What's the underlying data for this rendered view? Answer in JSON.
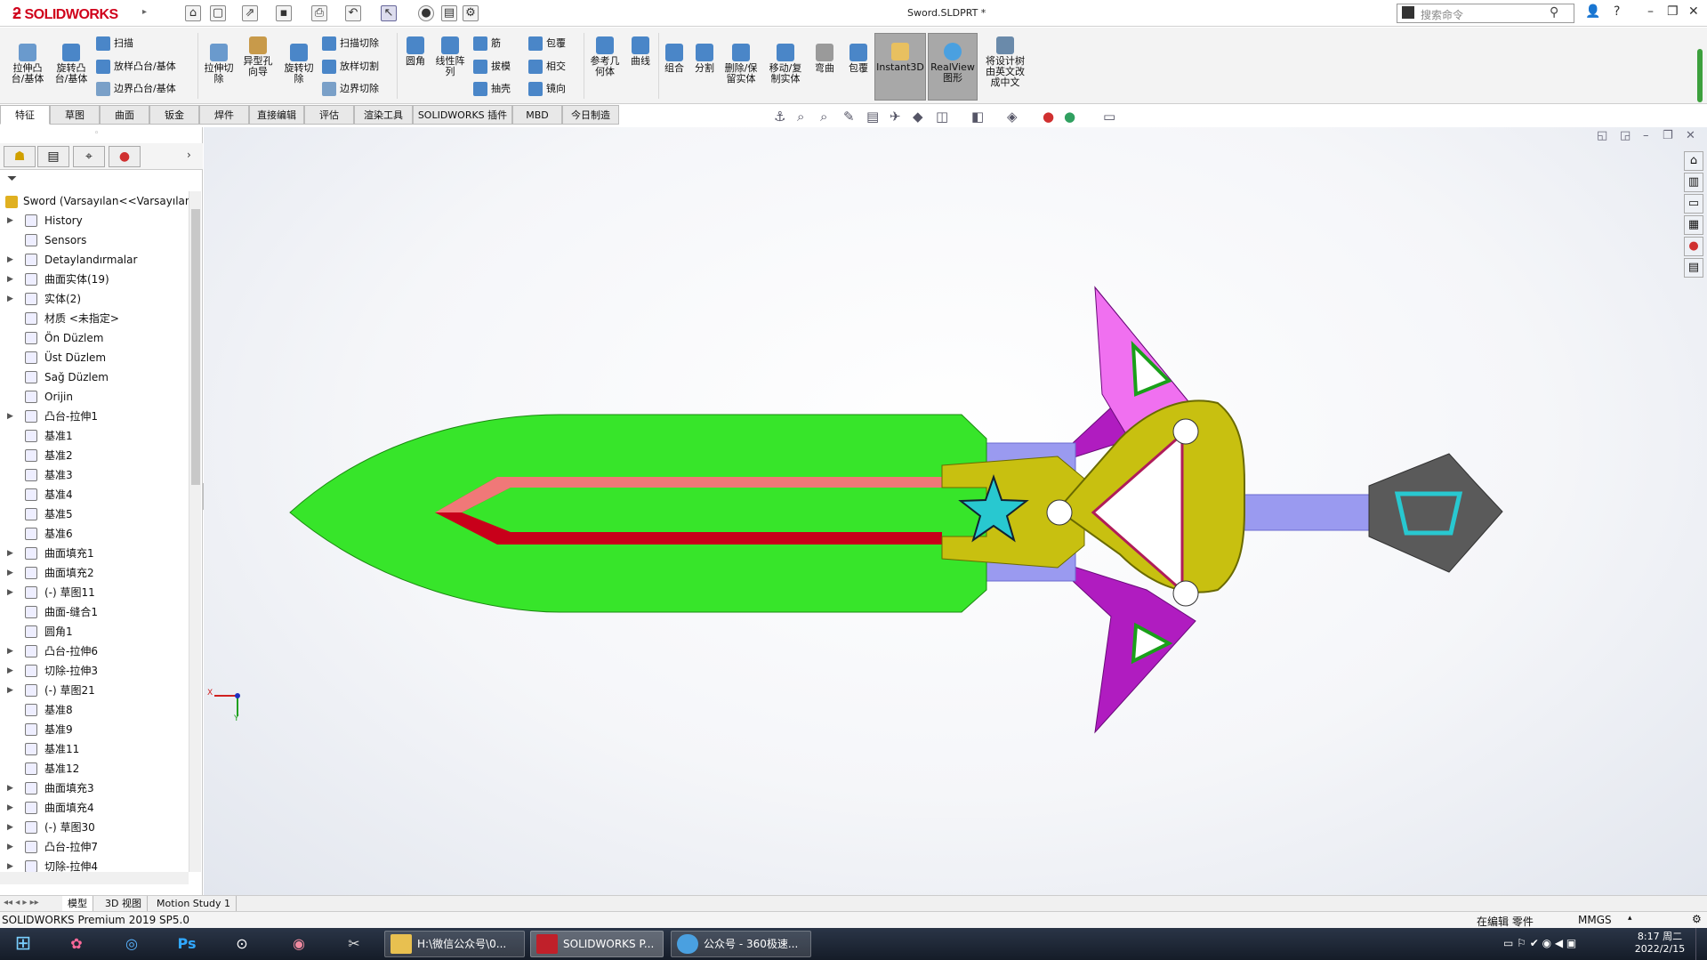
{
  "app": {
    "brand": "SOLIDWORKS",
    "document_title": "Sword.SLDPRT *",
    "search_placeholder": "搜索命令"
  },
  "ribbon": {
    "boss_extrude": "拉伸凸\n台/基体",
    "revolve_boss": "旋转凸\n台/基体",
    "sweep": "扫描",
    "loft_boss": "放样凸台/基体",
    "boundary_boss": "边界凸台/基体",
    "extrude_cut": "拉伸切\n除",
    "hole_wizard": "异型孔\n向导",
    "revolve_cut": "旋转切\n除",
    "swept_cut": "扫描切除",
    "lofted_cut": "放样切割",
    "boundary_cut": "边界切除",
    "fillet": "圆角",
    "linear_pattern": "线性阵\n列",
    "rib": "筋",
    "draft": "拔模",
    "shell": "抽壳",
    "wrap": "包覆",
    "intersect": "相交",
    "mirror": "镜向",
    "ref_geometry": "参考几\n何体",
    "curves": "曲线",
    "combine": "组合",
    "split": "分割",
    "delete_keep_body": "删除/保\n留实体",
    "move_copy_body": "移动/复\n制实体",
    "flex": "弯曲",
    "wrap2": "包覆",
    "instant3d": "Instant3D",
    "realview": "RealView\n图形",
    "translate_tree": "将设计树\n由英文改\n成中文"
  },
  "tabs": [
    "特征",
    "草图",
    "曲面",
    "钣金",
    "焊件",
    "直接编辑",
    "评估",
    "渲染工具",
    "SOLIDWORKS 插件",
    "MBD",
    "今日制造"
  ],
  "tree": {
    "root": "Sword  (Varsayılan<<Varsayılan",
    "items": [
      {
        "label": "History",
        "expand": true
      },
      {
        "label": "Sensors",
        "expand": false
      },
      {
        "label": "Detaylandırmalar",
        "expand": true
      },
      {
        "label": "曲面实体(19)",
        "expand": true
      },
      {
        "label": "实体(2)",
        "expand": true
      },
      {
        "label": "材质 <未指定>",
        "expand": false
      },
      {
        "label": "Ön Düzlem",
        "expand": false
      },
      {
        "label": "Üst Düzlem",
        "expand": false
      },
      {
        "label": "Sağ Düzlem",
        "expand": false
      },
      {
        "label": "Orijin",
        "expand": false
      },
      {
        "label": "凸台-拉伸1",
        "expand": true
      },
      {
        "label": "基准1",
        "expand": false
      },
      {
        "label": "基准2",
        "expand": false
      },
      {
        "label": "基准3",
        "expand": false
      },
      {
        "label": "基准4",
        "expand": false
      },
      {
        "label": "基准5",
        "expand": false
      },
      {
        "label": "基准6",
        "expand": false
      },
      {
        "label": "曲面填充1",
        "expand": true
      },
      {
        "label": "曲面填充2",
        "expand": true
      },
      {
        "label": "(-) 草图11",
        "expand": true
      },
      {
        "label": "曲面-缝合1",
        "expand": false
      },
      {
        "label": "圆角1",
        "expand": false
      },
      {
        "label": "凸台-拉伸6",
        "expand": true
      },
      {
        "label": "切除-拉伸3",
        "expand": true
      },
      {
        "label": "(-) 草图21",
        "expand": true
      },
      {
        "label": "基准8",
        "expand": false
      },
      {
        "label": "基准9",
        "expand": false
      },
      {
        "label": "基准11",
        "expand": false
      },
      {
        "label": "基准12",
        "expand": false
      },
      {
        "label": "曲面填充3",
        "expand": true
      },
      {
        "label": "曲面填充4",
        "expand": true
      },
      {
        "label": "(-) 草图30",
        "expand": true
      },
      {
        "label": "凸台-拉伸7",
        "expand": true
      },
      {
        "label": "切除-拉伸4",
        "expand": true
      }
    ]
  },
  "bottom_tabs": [
    "模型",
    "3D 视图",
    "Motion Study 1"
  ],
  "status": {
    "version": "SOLIDWORKS Premium 2019 SP5.0",
    "editing": "在编辑 零件",
    "units": "MMGS"
  },
  "taskbar": {
    "apps": [
      "H:\\微信公众号\\0...",
      "SOLIDWORKS P...",
      "公众号 - 360极速..."
    ],
    "time": "8:17 周二",
    "date": "2022/2/15"
  },
  "triad": {
    "x": "X",
    "y": "Y"
  },
  "colors": {
    "blade": "#37e52a",
    "guard": "#c8c010",
    "wing": "#b01cc0",
    "wing_light": "#f070f0",
    "star": "#28c8d0",
    "red": "#c8001a",
    "salmon": "#f07878",
    "handle": "#9a9af0",
    "pommel": "#555"
  }
}
